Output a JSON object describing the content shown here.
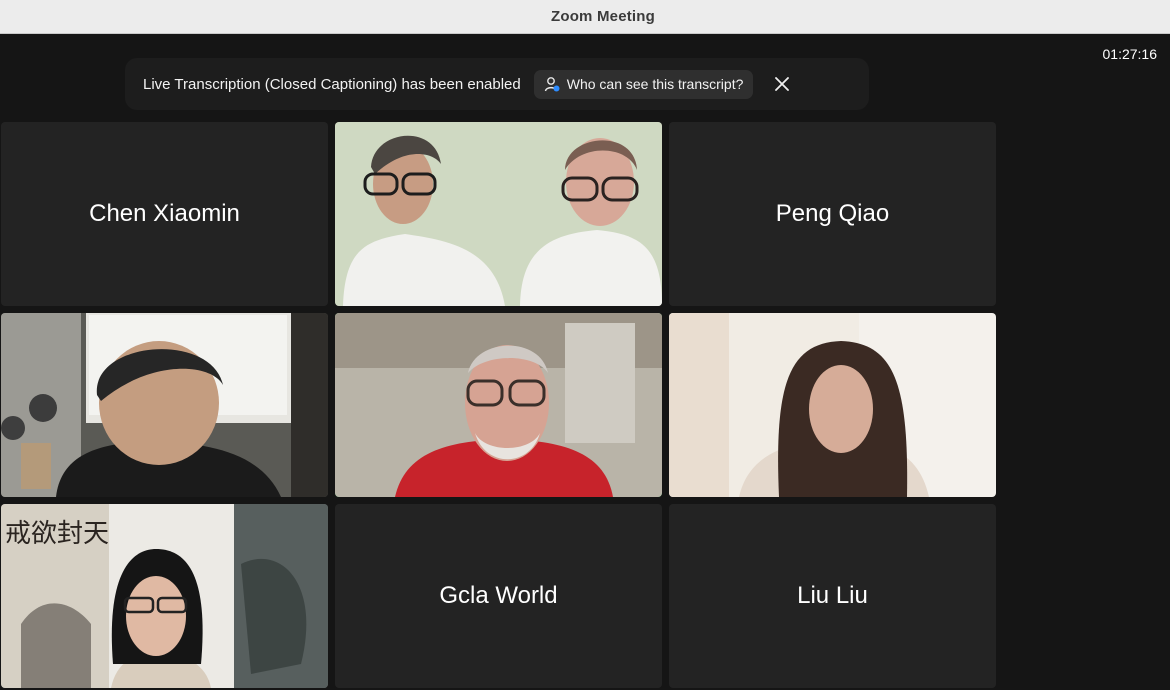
{
  "window": {
    "title": "Zoom Meeting"
  },
  "meeting": {
    "elapsed_time": "01:27:16"
  },
  "transcription_banner": {
    "message": "Live Transcription (Closed Captioning) has been enabled",
    "who_can_see_label": "Who can see this transcript?",
    "close_icon": "close-icon"
  },
  "participants": [
    {
      "name": "Chen Xiaomin",
      "video": false
    },
    {
      "name": "",
      "video": true
    },
    {
      "name": "Peng Qiao",
      "video": false
    },
    {
      "name": "",
      "video": true
    },
    {
      "name": "",
      "video": true,
      "active_speaker": true
    },
    {
      "name": "",
      "video": true
    },
    {
      "name": "",
      "video": true
    },
    {
      "name": "Gcla World",
      "video": false
    },
    {
      "name": "Liu Liu",
      "video": false
    }
  ],
  "colors": {
    "active_speaker_border": "#23c552",
    "background": "#151515",
    "tile": "#232323"
  }
}
